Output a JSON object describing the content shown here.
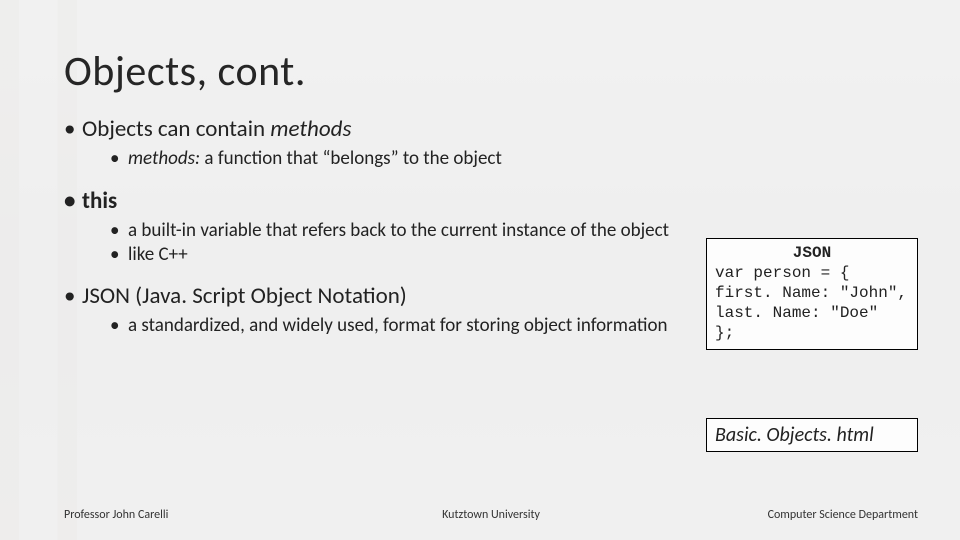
{
  "title": "Objects, cont.",
  "bullets": {
    "methods_header_plain": "Objects can contain ",
    "methods_header_em": "methods",
    "methods_def_em": "methods:",
    "methods_def_rest": " a function that “belongs” to the object",
    "this_header": "this",
    "this_sub1": "a built-in variable that refers back to the current instance of the object",
    "this_sub2": "like C++",
    "json_header": "JSON (Java. Script Object Notation)",
    "json_sub1": "a standardized, and widely used, format for storing object information"
  },
  "codebox": {
    "title": "JSON",
    "lines": [
      "var person = {",
      "first. Name: \"John\",",
      "last. Name: \"Doe\"",
      "};"
    ]
  },
  "filebox": "Basic. Objects. html",
  "footer": {
    "left": "Professor John Carelli",
    "center": "Kutztown University",
    "right": "Computer Science Department"
  }
}
